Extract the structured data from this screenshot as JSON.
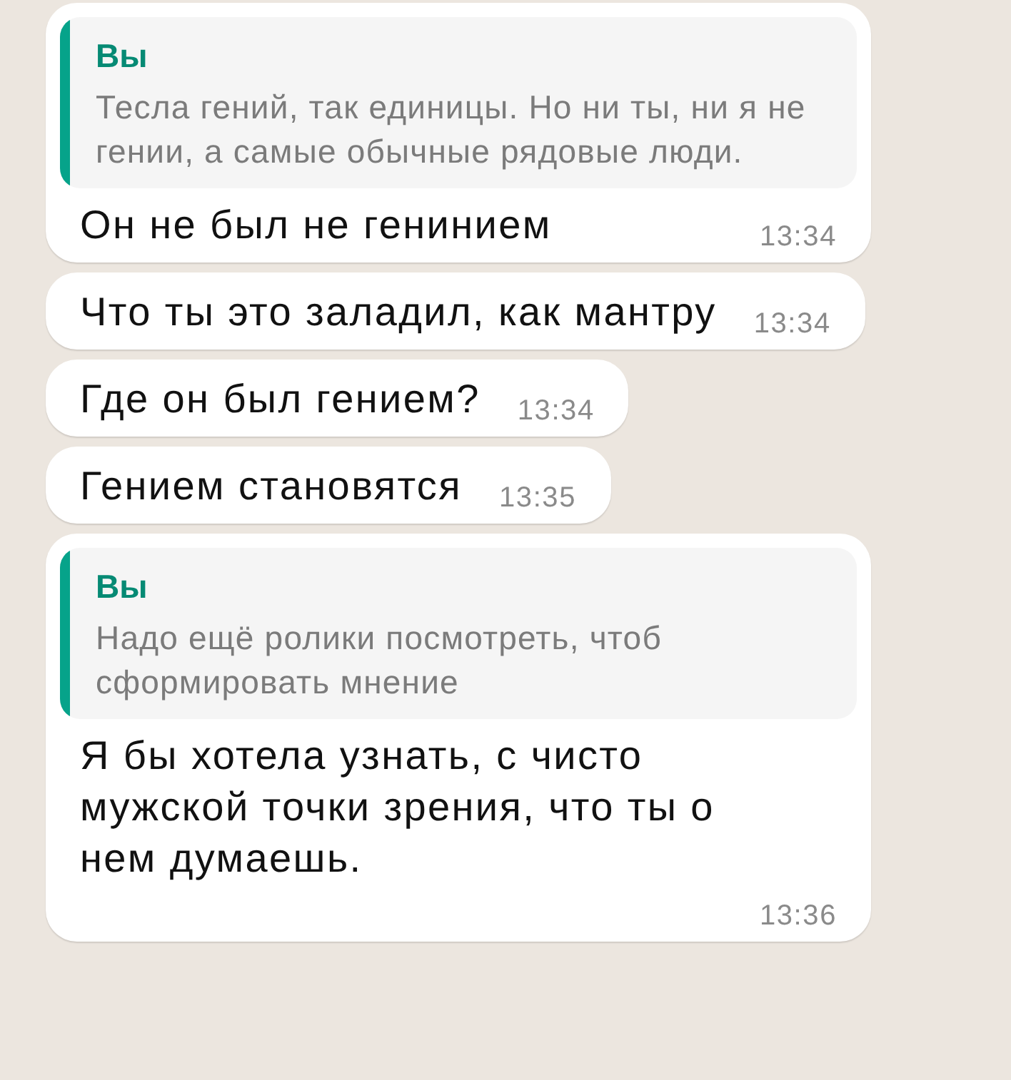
{
  "messages": [
    {
      "kind": "reply",
      "quote": {
        "author": "Вы",
        "text": "Тесла гений, так единицы. Но ни ты, ни я не гении, а самые обычные рядовые люди."
      },
      "text": "Он не был не генинием",
      "time": "13:34"
    },
    {
      "kind": "plain",
      "text": "Что ты это заладил, как мантру",
      "time": "13:34"
    },
    {
      "kind": "plain",
      "text": "Где он был гением?",
      "time": "13:34"
    },
    {
      "kind": "plain",
      "text": "Гением становятся",
      "time": "13:35"
    },
    {
      "kind": "reply",
      "quote": {
        "author": "Вы",
        "text": "Надо ещё ролики посмотреть, чтоб сформировать мнение"
      },
      "text": "Я бы хотела узнать, с чисто мужской точки зрения, что ты о нем думаешь.",
      "time": "13:36"
    }
  ]
}
